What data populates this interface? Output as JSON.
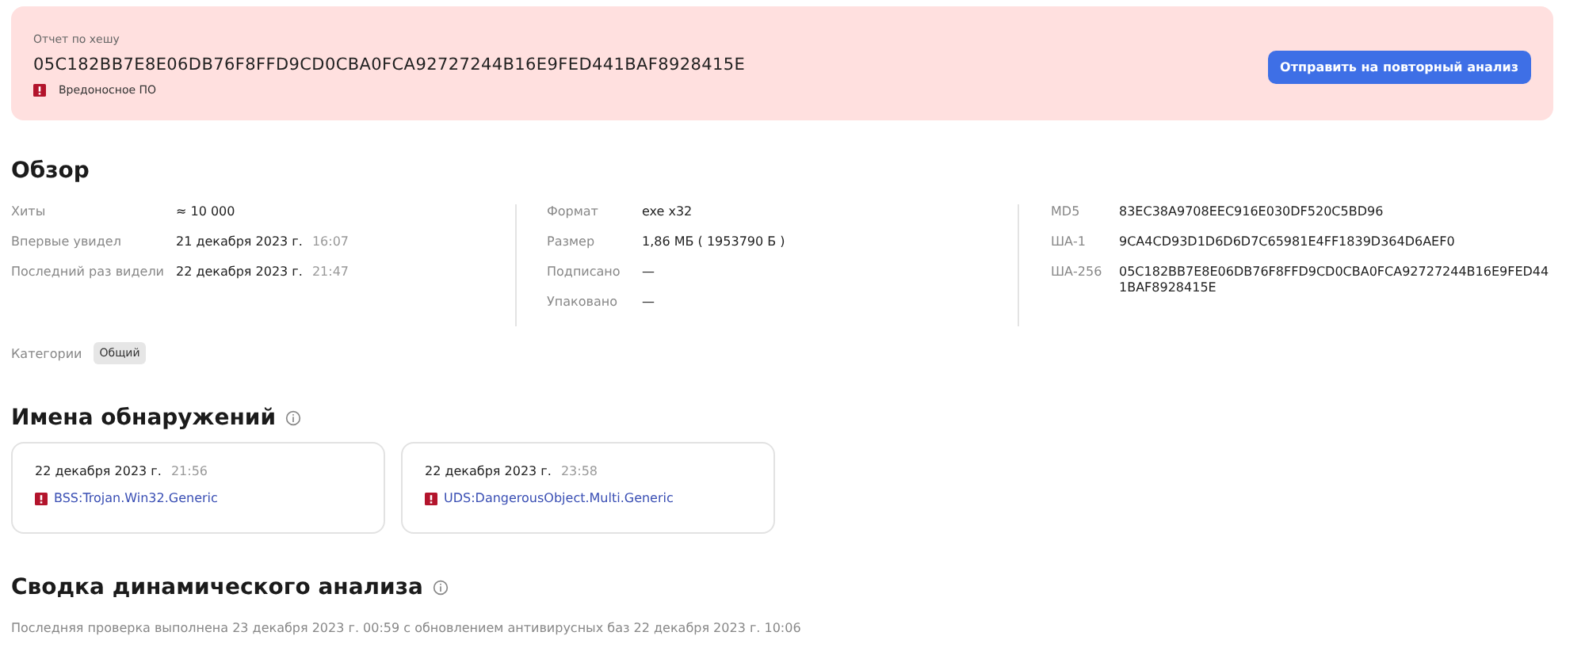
{
  "banner": {
    "caption": "Отчет по хешу",
    "hash": "05C182BB7E8E06DB76F8FFD9CD0CBA0FCA92727244B16E9FED441BAF8928415E",
    "verdict": "Вредоносное ПО",
    "button": "Отправить на повторный анализ"
  },
  "overview": {
    "title": "Обзор",
    "columns": [
      [
        {
          "label": "Хиты",
          "value": "≈ 10 000"
        },
        {
          "label": "Впервые увидел",
          "value": "21 декабря 2023 г.",
          "time": "16:07"
        },
        {
          "label": "Последний раз видели",
          "value": "22 декабря 2023 г.",
          "time": "21:47"
        }
      ],
      [
        {
          "label": "Формат",
          "value": "exe x32"
        },
        {
          "label": "Размер",
          "value": "1,86 МБ ( 1953790 Б )"
        },
        {
          "label": "Подписано",
          "value": "—"
        },
        {
          "label": "Упаковано",
          "value": "—"
        }
      ],
      [
        {
          "label": "MD5",
          "value": "83EC38A9708EEC916E030DF520C5BD96"
        },
        {
          "label": "ША-1",
          "value": "9CA4CD93D1D6D6D7C65981E4FF1839D364D6AEF0"
        },
        {
          "label": "ША-256",
          "value": "05C182BB7E8E06DB76F8FFD9CD0CBA0FCA92727244B16E9FED441BAF8928415E"
        }
      ]
    ],
    "categories": {
      "label": "Категории",
      "tags": [
        "Общий"
      ]
    }
  },
  "detections": {
    "title": "Имена обнаружений",
    "items": [
      {
        "date": "22 декабря 2023 г.",
        "time": "21:56",
        "name": "BSS:Trojan.Win32.Generic"
      },
      {
        "date": "22 декабря 2023 г.",
        "time": "23:58",
        "name": "UDS:DangerousObject.Multi.Generic"
      }
    ]
  },
  "dynamic": {
    "title": "Сводка динамического анализа",
    "text": "Последняя проверка выполнена 23 декабря 2023 г. 00:59 с обновлением антивирусных баз 22 декабря 2023 г. 10:06"
  }
}
